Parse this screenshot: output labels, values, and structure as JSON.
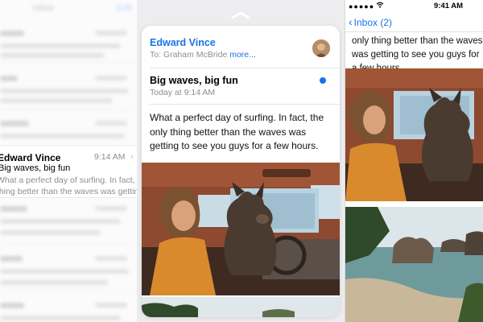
{
  "left_panel": {
    "ghost_title": "Inbox",
    "ghost_action": "Edit",
    "focused_message": {
      "sender": "Edward Vince",
      "time": "9:14 AM",
      "subject": "Big waves, big fun",
      "preview_line1": "What a perfect day of surfing. In fact, the only",
      "preview_line2": "thing better than the waves was getting to see..."
    }
  },
  "center_panel": {
    "from": "Edward Vince",
    "to_label": "To: Graham McBride",
    "to_more": "more...",
    "subject": "Big waves, big fun",
    "date": "Today at 9:14 AM",
    "body": "What a perfect day of surfing. In fact, the only thing better than the waves was getting to see you guys for a few hours.",
    "unread_color": "#1a73e8"
  },
  "right_panel": {
    "status": {
      "carrier": "●●●●●",
      "time": "9:41 AM"
    },
    "nav": {
      "back_label": "Inbox (2)"
    },
    "body_fragment": "only thing better than the waves was getting to see you guys for a few hours."
  },
  "colors": {
    "accent": "#1a73e8",
    "muted": "#8e8e93"
  }
}
